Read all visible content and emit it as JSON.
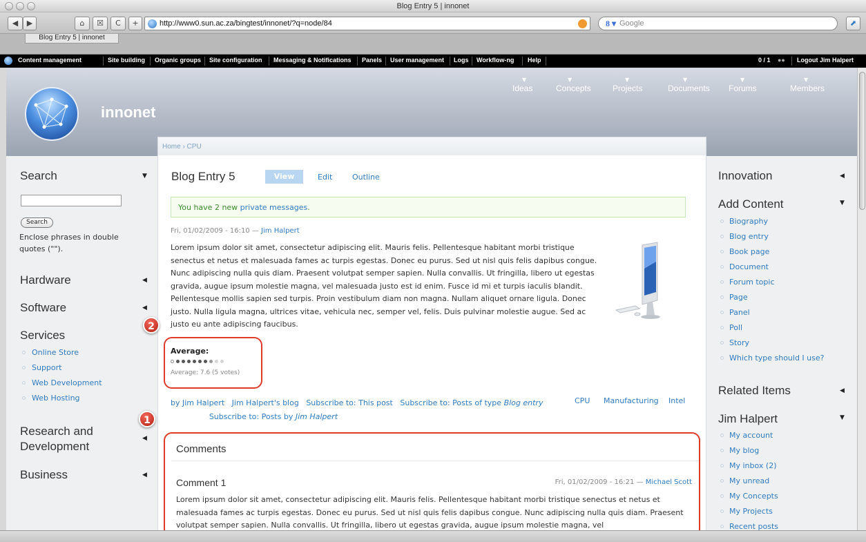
{
  "window": {
    "title": "Blog Entry 5 | innonet"
  },
  "browser": {
    "url": "http://www0.sun.ac.za/bingtest/innonet/?q=node/84",
    "search_placeholder": "Google",
    "tab_label": "Blog Entry 5 | innonet",
    "back": "◀",
    "forward": "▶",
    "home": "⌂",
    "bookmark": "☒",
    "reload": "C",
    "new_tab": "+"
  },
  "admin_menu": {
    "items": [
      "Content management",
      "Site building",
      "Organic groups",
      "Site configuration",
      "Messaging & Notifications",
      "Panels",
      "User management",
      "Logs",
      "Workflow-ng",
      "Help"
    ],
    "user_count": "0 / 1",
    "logout": "Logout Jim Halpert"
  },
  "site": {
    "name": "innonet",
    "nav": [
      "Ideas",
      "Concepts",
      "Projects",
      "Documents",
      "Forums",
      "Members"
    ]
  },
  "breadcrumb": "Home › CPU",
  "left": {
    "search_title": "Search",
    "search_button": "Search",
    "search_help": "Enclose phrases in double quotes (\"\").",
    "hardware": "Hardware",
    "software": "Software",
    "services": "Services",
    "services_links": [
      "Online Store",
      "Support",
      "Web Development",
      "Web Hosting"
    ],
    "research": "Research and Development",
    "business": "Business"
  },
  "post": {
    "title": "Blog Entry 5",
    "tabs": {
      "view": "View",
      "edit": "Edit",
      "outline": "Outline"
    },
    "message_prefix": "You have 2 new ",
    "message_link": "private messages",
    "message_suffix": ".",
    "date": "Fri, 01/02/2009 - 16:10 —",
    "author": "Jim Halpert",
    "body": "Lorem ipsum dolor sit amet, consectetur adipiscing elit. Mauris felis. Pellentesque habitant morbi tristique senectus et netus et malesuada fames ac turpis egestas. Donec eu purus. Sed ut nisl quis felis dapibus congue. Nunc adipiscing nulla quis diam. Praesent volutpat semper sapien. Nulla convallis. Ut fringilla, libero ut egestas gravida, augue ipsum molestie magna, vel malesuada justo est id enim. Fusce id mi et turpis iaculis blandit. Pellentesque mollis sapien sed turpis. Proin vestibulum diam non magna. Nullam aliquet ornare ligula. Donec justo. Nulla ligula magna, ultrices vitae, vehicula nec, semper vel, felis. Duis pulvinar molestie augue. Sed ac justo eu ante adipiscing faucibus.",
    "rating_label": "Average:",
    "rating_value": 7.6,
    "rating_max": 10,
    "rating_text": "Average: 7.6 (5 votes)",
    "links": {
      "by": "by Jim Halpert",
      "blog": "Jim Halpert's blog",
      "sub_post": "Subscribe to: This post",
      "sub_type_prefix": "Subscribe to: Posts of type",
      "sub_type_em": "Blog entry",
      "sub_by_prefix": "Subscribe to: Posts by",
      "sub_by_em": "Jim Halpert"
    },
    "terms": [
      "CPU",
      "Manufacturing",
      "Intel"
    ]
  },
  "comments": {
    "heading": "Comments",
    "items": [
      {
        "title": "Comment 1",
        "meta": "Fri, 01/02/2009 - 16:21 —",
        "author": "Michael Scott",
        "body": "Lorem ipsum dolor sit amet, consectetur adipiscing elit. Mauris felis. Pellentesque habitant morbi tristique senectus et netus et malesuada fames ac turpis egestas. Donec eu purus. Sed ut nisl quis felis dapibus congue. Nunc adipiscing nulla quis diam. Praesent volutpat semper sapien. Nulla convallis. Ut fringilla, libero ut egestas gravida, augue ipsum molestie magna, vel"
      }
    ]
  },
  "right": {
    "innovation": "Innovation",
    "add_content": "Add Content",
    "add_links": [
      "Biography",
      "Blog entry",
      "Book page",
      "Document",
      "Forum topic",
      "Page",
      "Panel",
      "Poll",
      "Story",
      "Which type should I use?"
    ],
    "related": "Related Items",
    "user_block": "Jim Halpert",
    "user_links": [
      "My account",
      "My blog",
      "My inbox (2)",
      "My unread",
      "My Concepts",
      "My Projects",
      "Recent posts"
    ]
  },
  "annotations": {
    "marker1": "1",
    "marker2": "2"
  },
  "colors": {
    "link": "#2f7bbf",
    "callout": "#e03a2a",
    "header": "#9aa3b1"
  }
}
